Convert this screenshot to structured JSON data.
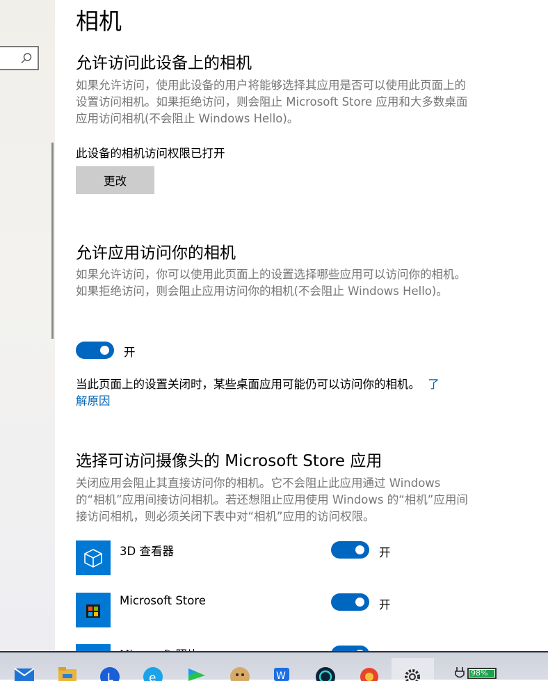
{
  "sidebar": {
    "search_placeholder": ""
  },
  "page": {
    "title": "相机"
  },
  "device_access": {
    "heading": "允许访问此设备上的相机",
    "description": "如果允许访问，使用此设备的用户将能够选择其应用是否可以使用此页面上的设置访问相机。如果拒绝访问，则会阻止 Microsoft Store 应用和大多数桌面应用访问相机(不会阻止 Windows Hello)。",
    "status": "此设备的相机访问权限已打开",
    "change_button": "更改"
  },
  "app_access": {
    "heading": "允许应用访问你的相机",
    "description": "如果允许访问，你可以使用此页面上的设置选择哪些应用可以访问你的相机。如果拒绝访问，则会阻止应用访问你的相机(不会阻止 Windows Hello)。",
    "toggle_state": "开",
    "note": "当此页面上的设置关闭时，某些桌面应用可能仍可以访问你的相机。",
    "learn_more_1": "了",
    "learn_more_2": "解原因"
  },
  "store_apps": {
    "heading": "选择可访问摄像头的 Microsoft Store 应用",
    "description": "关闭应用会阻止其直接访问你的相机。它不会阻止此应用通过 Windows 的“相机”应用间接访问相机。若还想阻止应用使用 Windows 的“相机”应用间接访问相机，则必须关闭下表中对“相机”应用的访问权限。",
    "apps": [
      {
        "name": "3D 查看器",
        "state": "开",
        "icon": "cube-icon"
      },
      {
        "name": "Microsoft Store",
        "state": "开",
        "icon": "store-bag-icon"
      },
      {
        "name": "Microsoft 照片",
        "state": "开",
        "icon": "photos-icon"
      }
    ]
  },
  "taskbar": {
    "battery_percent": "98%",
    "icons": [
      "mail-icon",
      "file-explorer-icon",
      "app-l-icon",
      "browser-e-icon",
      "video-player-icon",
      "avatar-dog-icon",
      "wps-icon",
      "music-icon",
      "game-icon",
      "settings-gear-icon",
      "power-plug-icon"
    ]
  },
  "colors": {
    "accent": "#0067c0",
    "tile": "#0078d4",
    "link": "#0063b1",
    "desc_text": "#767676"
  }
}
